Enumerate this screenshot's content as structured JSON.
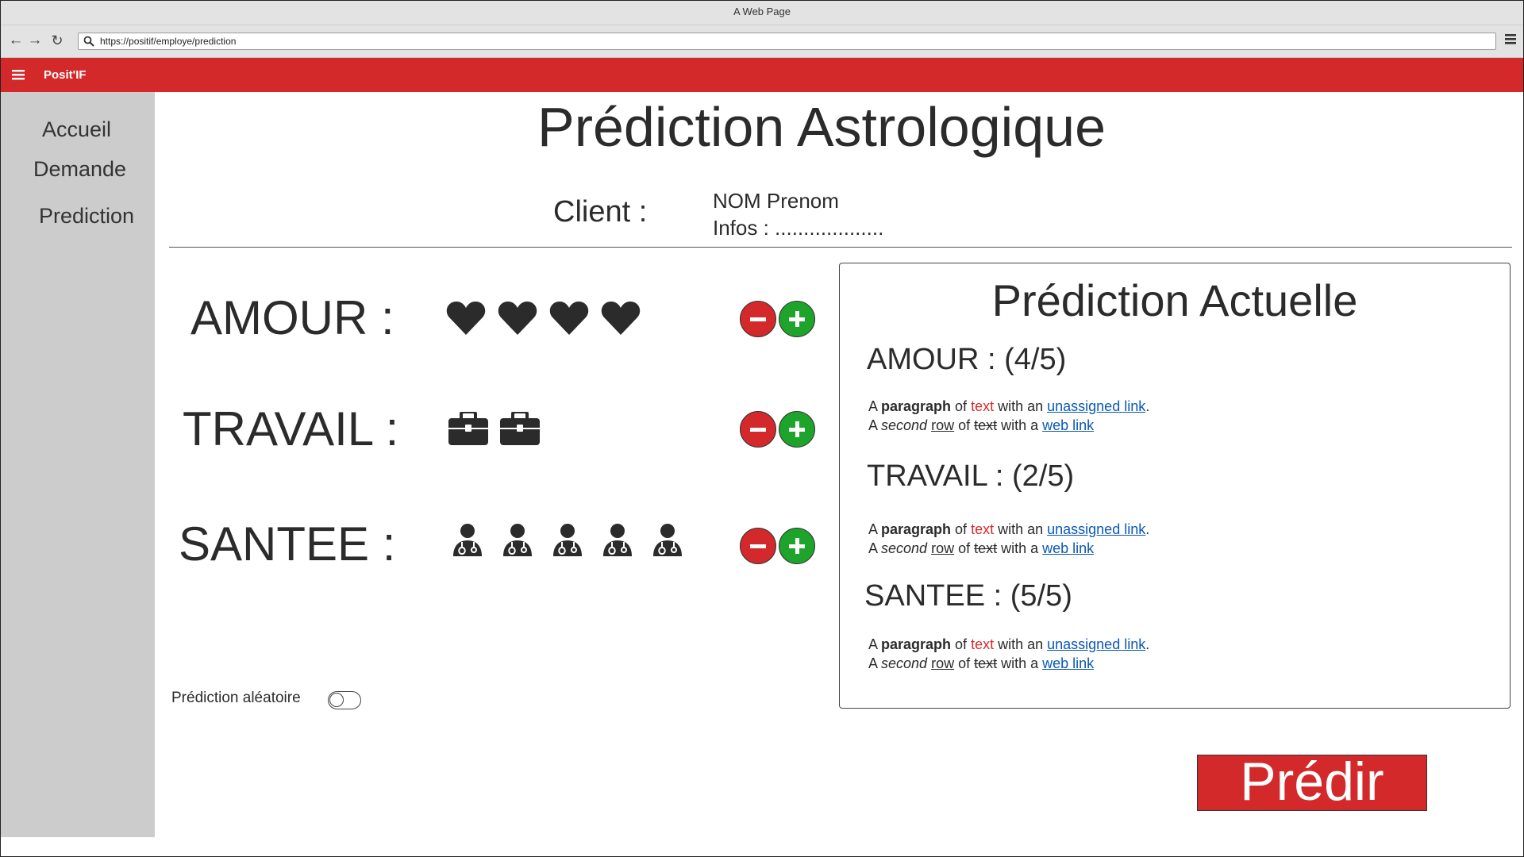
{
  "window": {
    "title": "A Web Page"
  },
  "browser": {
    "url": "https://positif/employe/prediction",
    "back_icon": "arrow-left",
    "forward_icon": "arrow-right",
    "reload_icon": "reload",
    "menu_icon": "hamburger"
  },
  "appbar": {
    "brand": "Posit'IF",
    "color": "#d3292b"
  },
  "sidebar": {
    "items": [
      {
        "label": "Accueil"
      },
      {
        "label": "Demande"
      },
      {
        "label": "Prediction"
      }
    ]
  },
  "main": {
    "title": "Prédiction Astrologique",
    "client_label": "Client :",
    "client_name": "NOM Prenom",
    "client_infos": "Infos : ...................",
    "categories": [
      {
        "label": "AMOUR :",
        "icon": "heart-icon",
        "count": 4
      },
      {
        "label": "TRAVAIL :",
        "icon": "briefcase-icon",
        "count": 2
      },
      {
        "label": "SANTEE :",
        "icon": "doctor-icon",
        "count": 5
      }
    ],
    "random_label": "Prédiction aléatoire",
    "random_on": false
  },
  "panel": {
    "title": "Prédiction Actuelle",
    "sections": [
      {
        "heading": "AMOUR : (4/5)"
      },
      {
        "heading": "TRAVAIL : (2/5)"
      },
      {
        "heading": "SANTEE : (5/5)"
      }
    ],
    "paragraph": {
      "line1": {
        "a": "A ",
        "b": "paragraph",
        "c": " of ",
        "d": "text",
        "e": " with an ",
        "f": "unassigned link",
        "g": "."
      },
      "line2": {
        "a": "A ",
        "b": "second",
        "c": " ",
        "d": "row",
        "e": " of ",
        "f": "text",
        "g": " with a ",
        "h": "web link"
      }
    }
  },
  "actions": {
    "predict_label": "Prédir"
  }
}
